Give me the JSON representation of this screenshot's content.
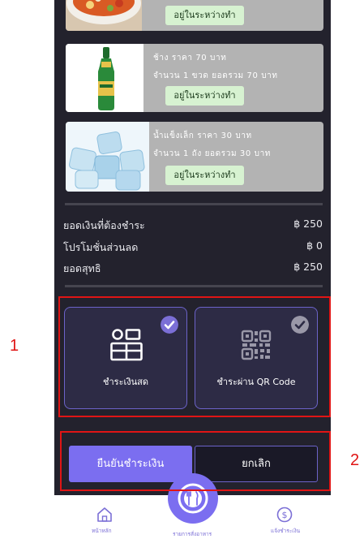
{
  "orders": [
    {
      "line1": "",
      "line2": "",
      "status": "อยู่ในระหว่างทำ",
      "thumb": "soup-bowl-image"
    },
    {
      "line1": "ช้าง ราคา 70 บาท",
      "line2": "จำนวน 1 ขวด ยอดรวม 70 บาท",
      "status": "อยู่ในระหว่างทำ",
      "thumb": "beer-bottle-image"
    },
    {
      "line1": "น้ำแข็งเล็ก ราคา 30 บาท",
      "line2": "จำนวน 1 ถัง ยอดรวม 30 บาท",
      "status": "อยู่ในระหว่างทำ",
      "thumb": "ice-cubes-image"
    }
  ],
  "summary": {
    "total_label": "ยอดเงินที่ต้องชำระ",
    "total_value": "฿ 250",
    "discount_label": "โปรโมชั่นส่วนลด",
    "discount_value": "฿ 0",
    "net_label": "ยอดสุทธิ",
    "net_value": "฿ 250"
  },
  "payment_methods": [
    {
      "label": "ชำระเงินสด",
      "icon": "cash-register-icon",
      "selected": true
    },
    {
      "label": "ชำระผ่าน QR Code",
      "icon": "qr-code-icon",
      "selected": false
    }
  ],
  "actions": {
    "confirm_label": "ยืนยันชำระเงิน",
    "cancel_label": "ยกเลิก"
  },
  "nav": {
    "home_label": "หน้าหลัก",
    "orders_label": "รายการสั่งอาหาร",
    "payment_label": "แจ้งชำระเงิน"
  },
  "callouts": {
    "one": "1",
    "two": "2"
  },
  "colors": {
    "background": "#23222d",
    "accent": "#7b6fd6",
    "confirm_button": "#7b6ef0",
    "callout": "#e01515",
    "status_pill": "#d7f2d1"
  }
}
